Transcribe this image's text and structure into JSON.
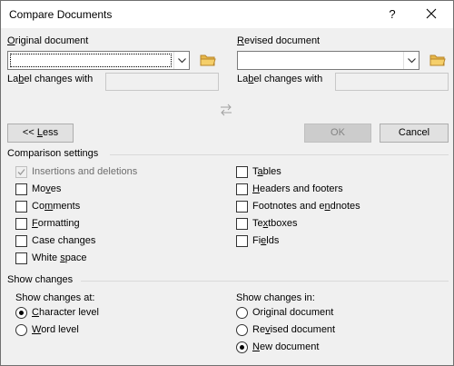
{
  "window": {
    "title": "Compare Documents",
    "help_label": "?"
  },
  "original": {
    "section_label_pre": "",
    "section_label_u": "O",
    "section_label_post": "riginal document",
    "label_changes_pre": "La",
    "label_changes_u": "b",
    "label_changes_post": "el changes with",
    "combo_value": "",
    "label_value": ""
  },
  "revised": {
    "section_label_u": "R",
    "section_label_post": "evised document",
    "label_changes_pre": "La",
    "label_changes_u": "b",
    "label_changes_post": "el changes with",
    "combo_value": "",
    "label_value": ""
  },
  "swap_icon": "swap-arrows-icon",
  "buttons": {
    "less_pre": "<< ",
    "less_u": "L",
    "less_post": "ess",
    "ok": "OK",
    "cancel": "Cancel"
  },
  "comparison_settings": {
    "title": "Comparison settings",
    "left": [
      {
        "pre": "",
        "u": "",
        "post": "Insertions and deletions",
        "checked": true,
        "disabled": true
      },
      {
        "pre": "Mo",
        "u": "v",
        "post": "es",
        "checked": false,
        "disabled": false
      },
      {
        "pre": "Co",
        "u": "m",
        "post": "ments",
        "checked": false,
        "disabled": false
      },
      {
        "pre": "",
        "u": "F",
        "post": "ormatting",
        "checked": false,
        "disabled": false
      },
      {
        "pre": "Case chan",
        "u": "g",
        "post": "es",
        "checked": false,
        "disabled": false
      },
      {
        "pre": "White ",
        "u": "s",
        "post": "pace",
        "checked": false,
        "disabled": false
      }
    ],
    "right": [
      {
        "pre": "T",
        "u": "a",
        "post": "bles",
        "checked": false
      },
      {
        "pre": "",
        "u": "H",
        "post": "eaders and footers",
        "checked": false
      },
      {
        "pre": "Footnotes and e",
        "u": "n",
        "post": "dnotes",
        "checked": false
      },
      {
        "pre": "Te",
        "u": "x",
        "post": "tboxes",
        "checked": false
      },
      {
        "pre": "Fi",
        "u": "e",
        "post": "lds",
        "checked": false
      }
    ]
  },
  "show_changes": {
    "title": "Show changes",
    "at_label": "Show changes at:",
    "at": [
      {
        "pre": "",
        "u": "C",
        "post": "haracter level",
        "selected": true
      },
      {
        "pre": "",
        "u": "W",
        "post": "ord level",
        "selected": false
      }
    ],
    "in_label": "Show changes in:",
    "in": [
      {
        "pre": "Ori",
        "u": "g",
        "post": "inal document",
        "selected": false
      },
      {
        "pre": "Re",
        "u": "v",
        "post": "ised document",
        "selected": false
      },
      {
        "pre": "",
        "u": "N",
        "post": "ew document",
        "selected": true
      }
    ]
  },
  "colors": {
    "focus_border": "#0078d7",
    "background": "#f0f0f0"
  }
}
